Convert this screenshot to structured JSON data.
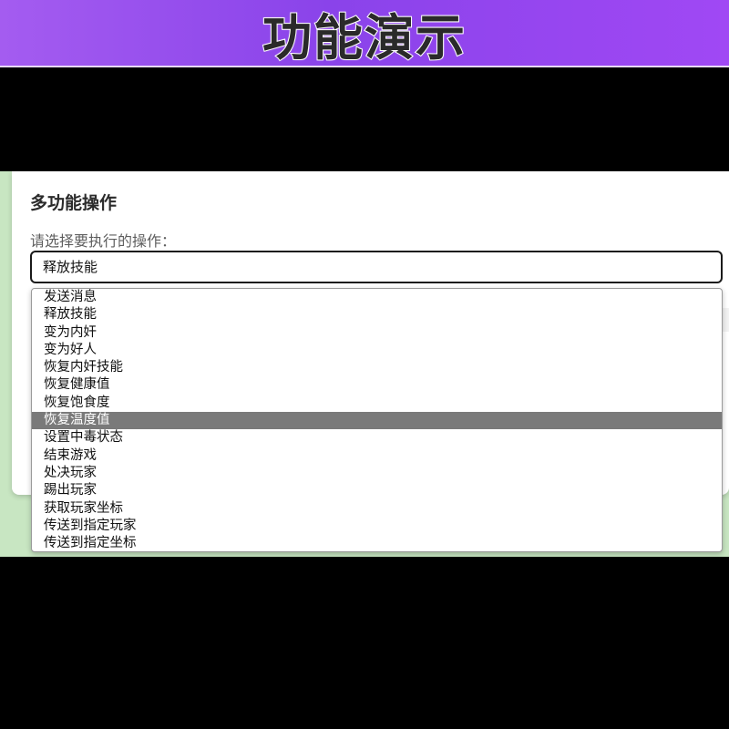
{
  "banner": {
    "title": "功能演示"
  },
  "card": {
    "title": "多功能操作",
    "select_label": "请选择要执行的操作：",
    "selected_value": "释放技能"
  },
  "dropdown": {
    "highlighted_index": 7,
    "options": [
      "发送消息",
      "释放技能",
      "变为内奸",
      "变为好人",
      "恢复内奸技能",
      "恢复健康值",
      "恢复饱食度",
      "恢复温度值",
      "设置中毒状态",
      "结束游戏",
      "处决玩家",
      "踢出玩家",
      "获取玩家坐标",
      "传送到指定玩家",
      "传送到指定坐标"
    ]
  }
}
